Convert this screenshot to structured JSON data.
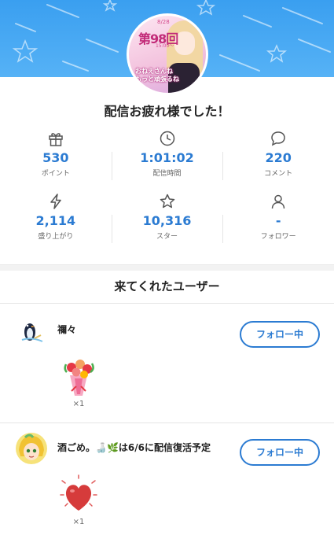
{
  "header": {
    "avatar_text": {
      "date": "8/28",
      "episode": "第98回",
      "time": "15:00〜",
      "tagline": "おねえさんね\nもっと頑張るね"
    },
    "colors": {
      "banner": "#3a9ff0",
      "accent": "#2b7bd2"
    }
  },
  "title": "配信お疲れ様でした！",
  "stats": [
    {
      "icon": "gift-icon",
      "value": "530",
      "label": "ポイント"
    },
    {
      "icon": "clock-icon",
      "value": "1:01:02",
      "label": "配信時間"
    },
    {
      "icon": "comment-icon",
      "value": "220",
      "label": "コメント"
    },
    {
      "icon": "lightning-icon",
      "value": "2,114",
      "label": "盛り上がり"
    },
    {
      "icon": "star-icon",
      "value": "10,316",
      "label": "スター"
    },
    {
      "icon": "person-icon",
      "value": "-",
      "label": "フォロワー"
    }
  ],
  "section_title": "来てくれたユーザー",
  "users": [
    {
      "name": "禰々",
      "follow_label": "フォロー中",
      "gift_icon": "bouquet-icon",
      "gift_count": "×1"
    },
    {
      "name": "酒ごめ。🍶🌿は6/6に配信復活予定",
      "follow_label": "フォロー中",
      "gift_icon": "heart-icon",
      "gift_count": "×1"
    }
  ]
}
